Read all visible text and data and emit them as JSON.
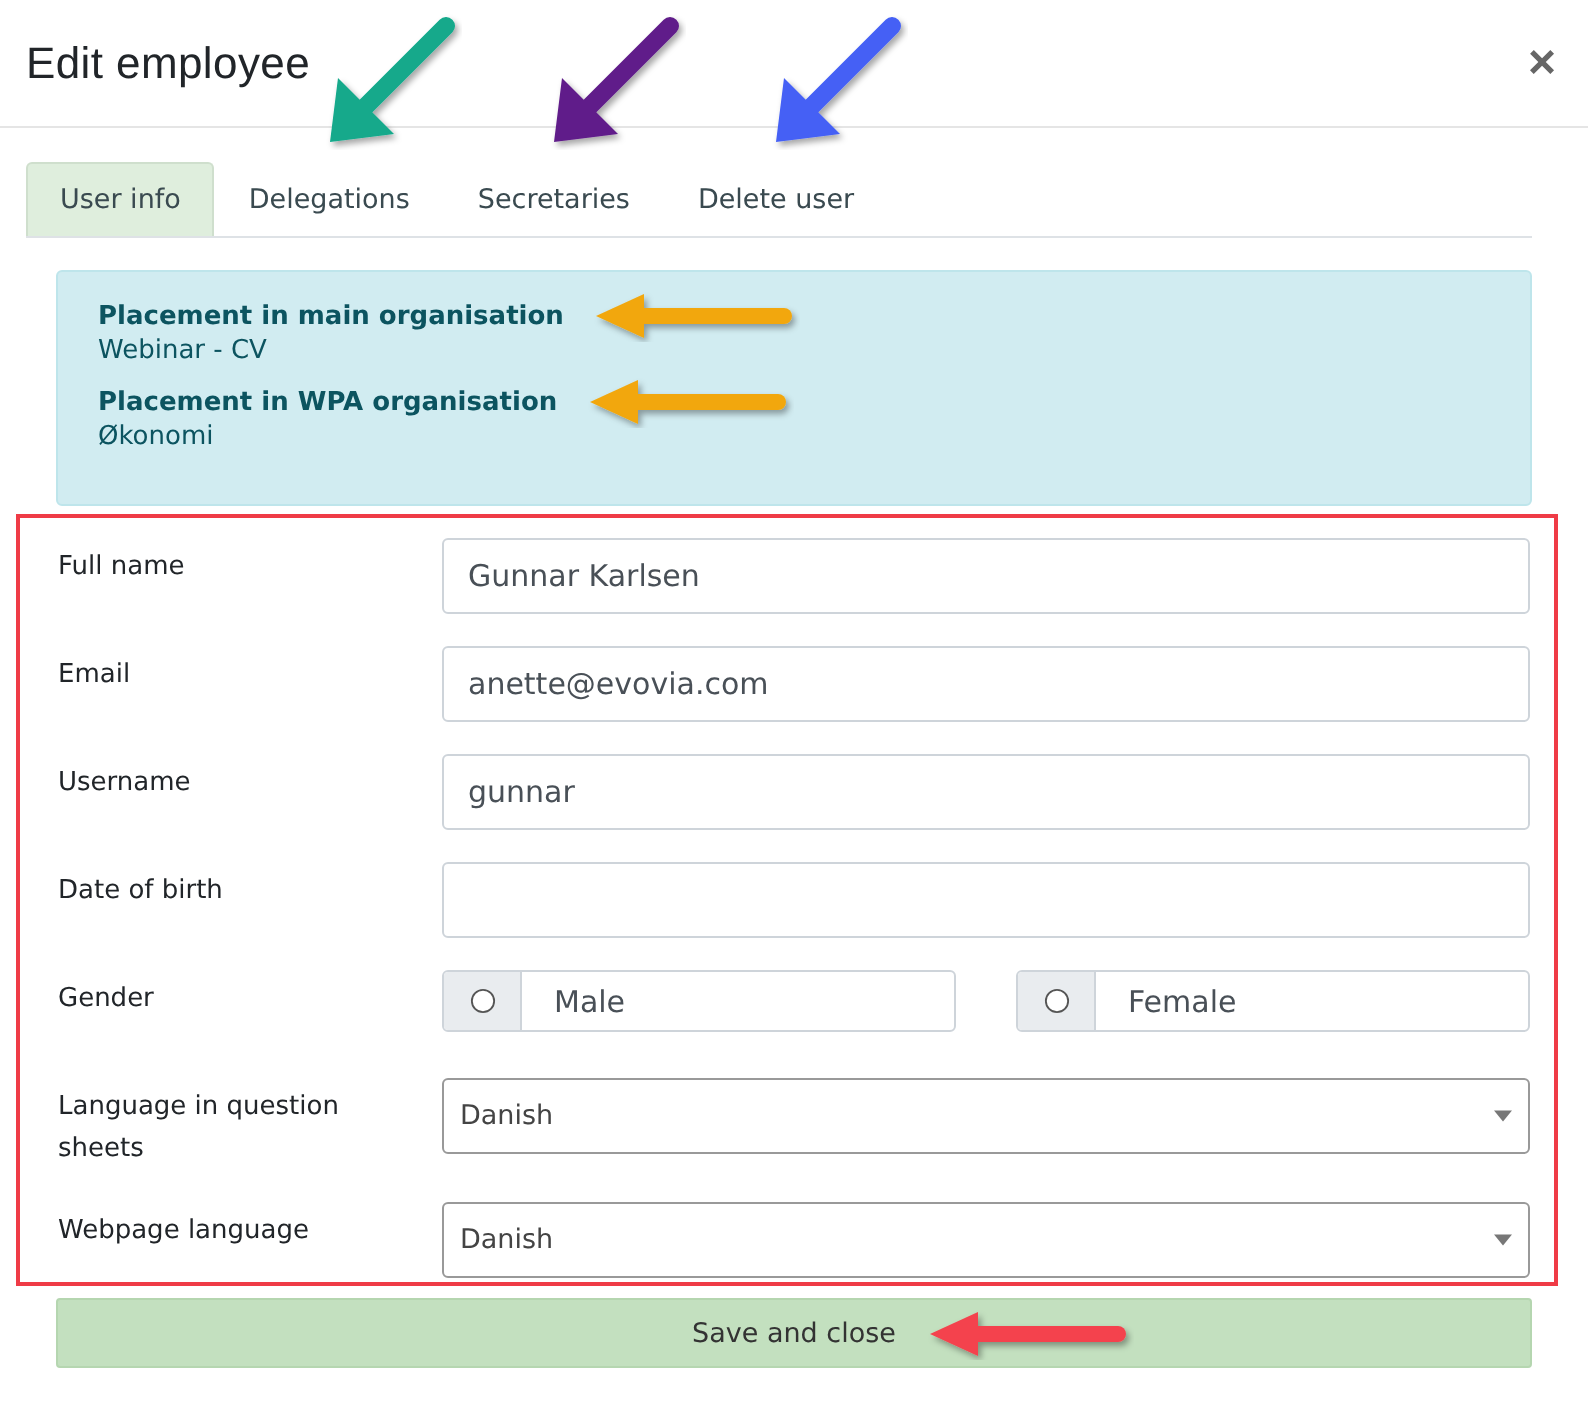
{
  "dialog": {
    "title": "Edit employee",
    "close": "×"
  },
  "tabs": [
    {
      "label": "User info",
      "selected": true
    },
    {
      "label": "Delegations",
      "selected": false,
      "color": "#13a98b"
    },
    {
      "label": "Secretaries",
      "selected": false,
      "color": "#611f8a"
    },
    {
      "label": "Delete user",
      "selected": false,
      "color": "#4460f5"
    }
  ],
  "info": [
    {
      "label": "Placement in main organisation",
      "value": "Webinar - CV",
      "color": "#f2a70c"
    },
    {
      "label": "Placement in WPA organisation",
      "value": "Økonomi",
      "color": "#f2a70c"
    }
  ],
  "form": {
    "highlighted": true,
    "fields": [
      {
        "kind": "text",
        "label": "Full name",
        "value": "Gunnar Karlsen"
      },
      {
        "kind": "text",
        "label": "Email",
        "value": "anette@evovia.com"
      },
      {
        "kind": "text",
        "label": "Username",
        "value": "gunnar"
      },
      {
        "kind": "text",
        "label": "Date of birth"
      },
      {
        "kind": "radio",
        "label": "Gender",
        "options": [
          {
            "label": "Male",
            "selected": false
          },
          {
            "label": "Female",
            "selected": false
          }
        ]
      },
      {
        "kind": "select",
        "label": "Language in question sheets",
        "value": "Danish"
      },
      {
        "kind": "select",
        "label": "Webpage language",
        "value": "Danish"
      }
    ]
  },
  "save_button": {
    "label": "Save and close",
    "color": "#f4434d"
  }
}
